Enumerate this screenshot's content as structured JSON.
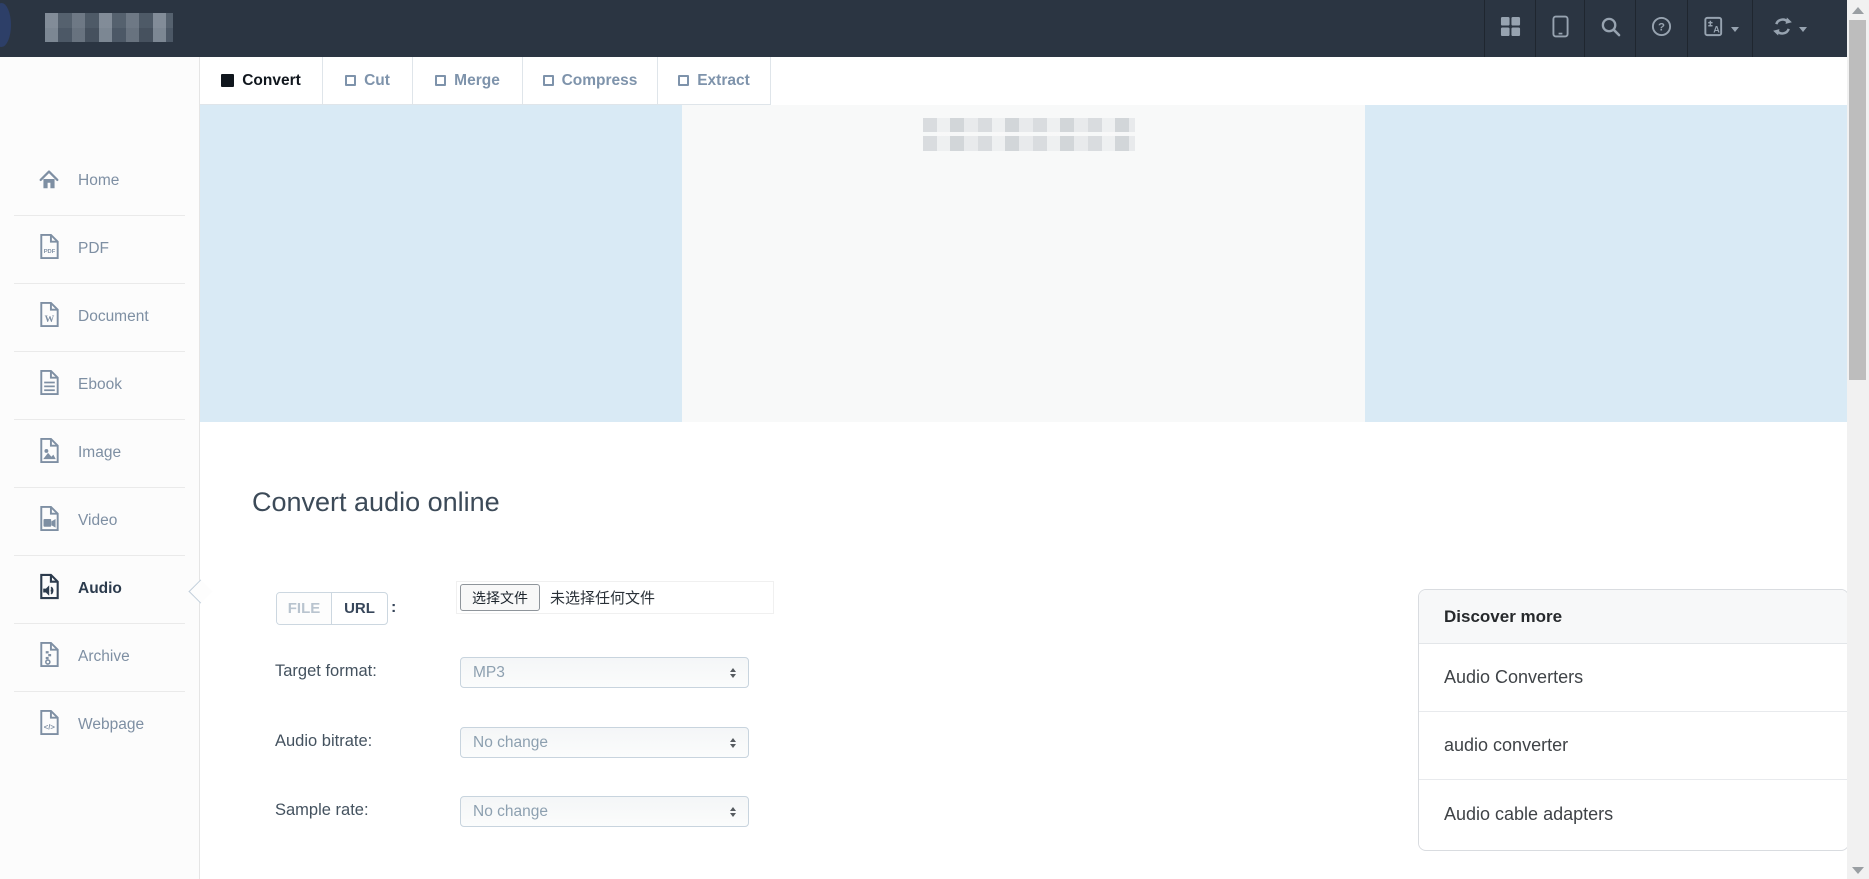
{
  "topbar": {
    "logo": "blurred-site-logo",
    "nav_icons": [
      {
        "name": "apps-grid-icon"
      },
      {
        "name": "mobile-device-icon"
      },
      {
        "name": "search-icon"
      },
      {
        "name": "help-icon"
      },
      {
        "name": "language-icon",
        "has_caret": true
      },
      {
        "name": "refresh-icon",
        "has_caret": true
      }
    ]
  },
  "tabs": [
    {
      "label": "Convert",
      "active": true
    },
    {
      "label": "Cut",
      "active": false
    },
    {
      "label": "Merge",
      "active": false
    },
    {
      "label": "Compress",
      "active": false
    },
    {
      "label": "Extract",
      "active": false
    }
  ],
  "sidebar": {
    "items": [
      {
        "label": "Home",
        "icon": "home-icon",
        "active": false
      },
      {
        "label": "PDF",
        "icon": "file-pdf-icon",
        "active": false
      },
      {
        "label": "Document",
        "icon": "file-word-icon",
        "active": false
      },
      {
        "label": "Ebook",
        "icon": "file-text-icon",
        "active": false
      },
      {
        "label": "Image",
        "icon": "file-image-icon",
        "active": false
      },
      {
        "label": "Video",
        "icon": "file-video-icon",
        "active": false
      },
      {
        "label": "Audio",
        "icon": "file-audio-icon",
        "active": true
      },
      {
        "label": "Archive",
        "icon": "file-archive-icon",
        "active": false
      },
      {
        "label": "Webpage",
        "icon": "file-code-icon",
        "active": false
      }
    ]
  },
  "main": {
    "heading": "Convert audio online",
    "source_toggle": {
      "file_label": "FILE",
      "url_label": "URL",
      "colon": ":"
    },
    "file_input": {
      "button_label": "选择文件",
      "status_text": "未选择任何文件"
    },
    "fields": [
      {
        "label": "Target format:",
        "value": "MP3"
      },
      {
        "label": "Audio bitrate:",
        "value": "No change"
      },
      {
        "label": "Sample rate:",
        "value": "No change"
      }
    ]
  },
  "discover": {
    "title": "Discover more",
    "items": [
      {
        "label": "Audio Converters"
      },
      {
        "label": "audio converter"
      },
      {
        "label": "Audio cable adapters"
      }
    ]
  },
  "colors": {
    "topbar_bg": "#2b3542",
    "band_blue": "#d9eaf5",
    "band_gray": "#f8f9f9",
    "inactive_tab_text": "#7e93ab",
    "active_tab_text": "#10161d",
    "sidebar_text": "#7e8fa3",
    "sidebar_active_text": "#2c3b4d"
  }
}
